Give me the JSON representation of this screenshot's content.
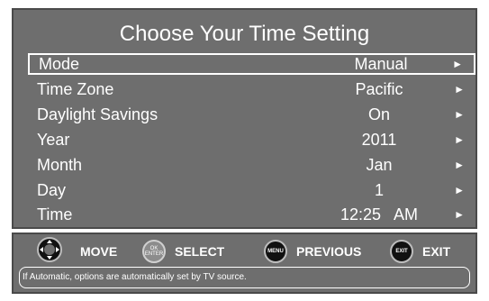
{
  "title": "Choose Your Time Setting",
  "rows": [
    {
      "label": "Mode",
      "value": "Manual",
      "selected": true
    },
    {
      "label": "Time Zone",
      "value": "Pacific"
    },
    {
      "label": "Daylight Savings",
      "value": "On"
    },
    {
      "label": "Year",
      "value": "2011"
    },
    {
      "label": "Month",
      "value": "Jan"
    },
    {
      "label": "Day",
      "value": "1"
    },
    {
      "label": "Time",
      "value": "12:25   AM"
    }
  ],
  "arrow": "►",
  "controls": {
    "move": "MOVE",
    "select": "SELECT",
    "ok_top": "OK",
    "ok_bottom": "ENTER",
    "previous": "PREVIOUS",
    "menu_icon": "MENU",
    "exit": "EXIT",
    "exit_icon": "EXIT"
  },
  "hint": "If Automatic, options are automatically set by TV source.",
  "colors": {
    "panel": "#6e6e6e",
    "text": "#ffffff",
    "border": "#4a4a4a"
  }
}
